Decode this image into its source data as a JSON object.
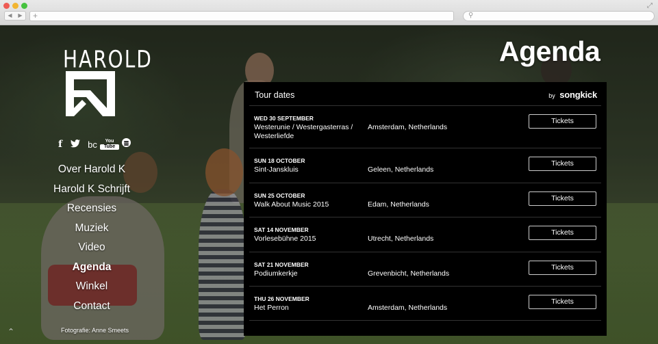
{
  "browser": {
    "back": "◀",
    "forward": "▶",
    "new_tab": "+",
    "search_icon": "search-icon",
    "expand_icon": "expand-icon"
  },
  "logo": {
    "text": "HAROLD"
  },
  "social": [
    "f",
    "twitter",
    "bc",
    "YouTube",
    "spotify"
  ],
  "social_labels": {
    "fb": "f",
    "bc": "bc",
    "yt_top": "You",
    "yt_bottom": "Tube"
  },
  "nav": {
    "items": [
      {
        "label": "Over Harold K"
      },
      {
        "label": "Harold K Schrijft"
      },
      {
        "label": "Recensies"
      },
      {
        "label": "Muziek"
      },
      {
        "label": "Video"
      },
      {
        "label": "Agenda"
      },
      {
        "label": "Winkel"
      },
      {
        "label": "Contact"
      }
    ],
    "active": "Agenda"
  },
  "credit": "Fotografie: Anne Smeets",
  "page_title": "Agenda",
  "agenda": {
    "title": "Tour dates",
    "brand_by": "by",
    "brand_name": "songkick",
    "events": [
      {
        "date": "WED 30 SEPTEMBER",
        "venue": "Westerunie / Westergasterras / Westerliefde",
        "location": "Amsterdam, Netherlands",
        "button": "Tickets"
      },
      {
        "date": "SUN 18 OCTOBER",
        "venue": "Sint-Janskluis",
        "location": "Geleen, Netherlands",
        "button": "Tickets"
      },
      {
        "date": "SUN 25 OCTOBER",
        "venue": "Walk About Music 2015",
        "location": "Edam, Netherlands",
        "button": "Tickets"
      },
      {
        "date": "SAT 14 NOVEMBER",
        "venue": "Vorlesebühne 2015",
        "location": "Utrecht, Netherlands",
        "button": "Tickets"
      },
      {
        "date": "SAT 21 NOVEMBER",
        "venue": "Podiumkerkje",
        "location": "Grevenbicht, Netherlands",
        "button": "Tickets"
      },
      {
        "date": "THU 26 NOVEMBER",
        "venue": "Het Perron",
        "location": "Amsterdam, Netherlands",
        "button": "Tickets"
      }
    ]
  },
  "colors": {
    "panel_bg": "#000000",
    "text": "#ffffff",
    "divider": "#333333"
  }
}
